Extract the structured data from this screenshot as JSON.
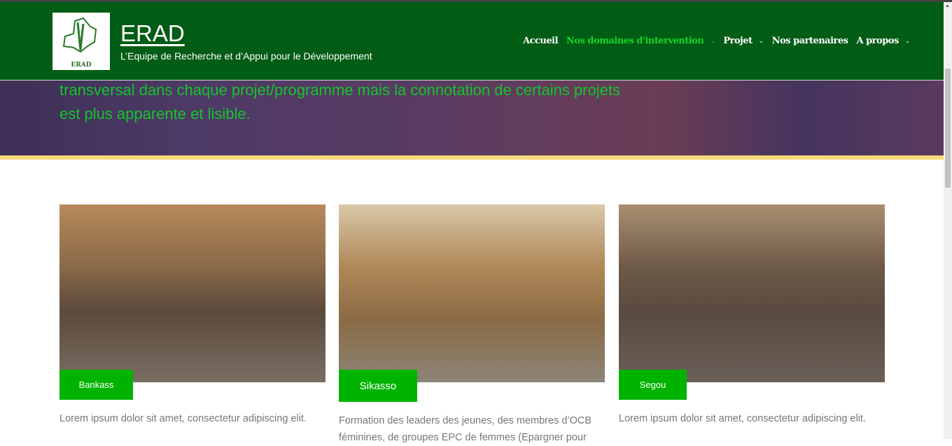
{
  "header": {
    "logo_text": "ERAD",
    "title": "ERAD",
    "tagline": "L’Equipe de Recherche et d’Appui pour le Développement",
    "nav": [
      {
        "label": "Accueil",
        "dropdown": false,
        "active": false
      },
      {
        "label": "Nos domaines d'intervention",
        "dropdown": true,
        "active": true
      },
      {
        "label": "Projet",
        "dropdown": true,
        "active": false
      },
      {
        "label": "Nos partenaires",
        "dropdown": false,
        "active": false
      },
      {
        "label": "A propos",
        "dropdown": true,
        "active": false
      }
    ]
  },
  "hero": {
    "text": "transversal dans chaque projet/programme mais la connotation de certains projets est plus apparente et lisible."
  },
  "cards": [
    {
      "label": "Bankass",
      "description": "Lorem ipsum dolor sit amet, consectetur adipiscing elit."
    },
    {
      "label": "Sikasso",
      "description": "Formation des leaders des jeunes, des membres d’OCB féminines, de groupes EPC de femmes (Epargner pour"
    },
    {
      "label": "Segou",
      "description": "Lorem ipsum dolor sit amet, consectetur adipiscing elit."
    }
  ],
  "colors": {
    "header": "#015c15",
    "accent": "#00b300",
    "active_nav": "#19d628",
    "band": "#f6d97a"
  }
}
